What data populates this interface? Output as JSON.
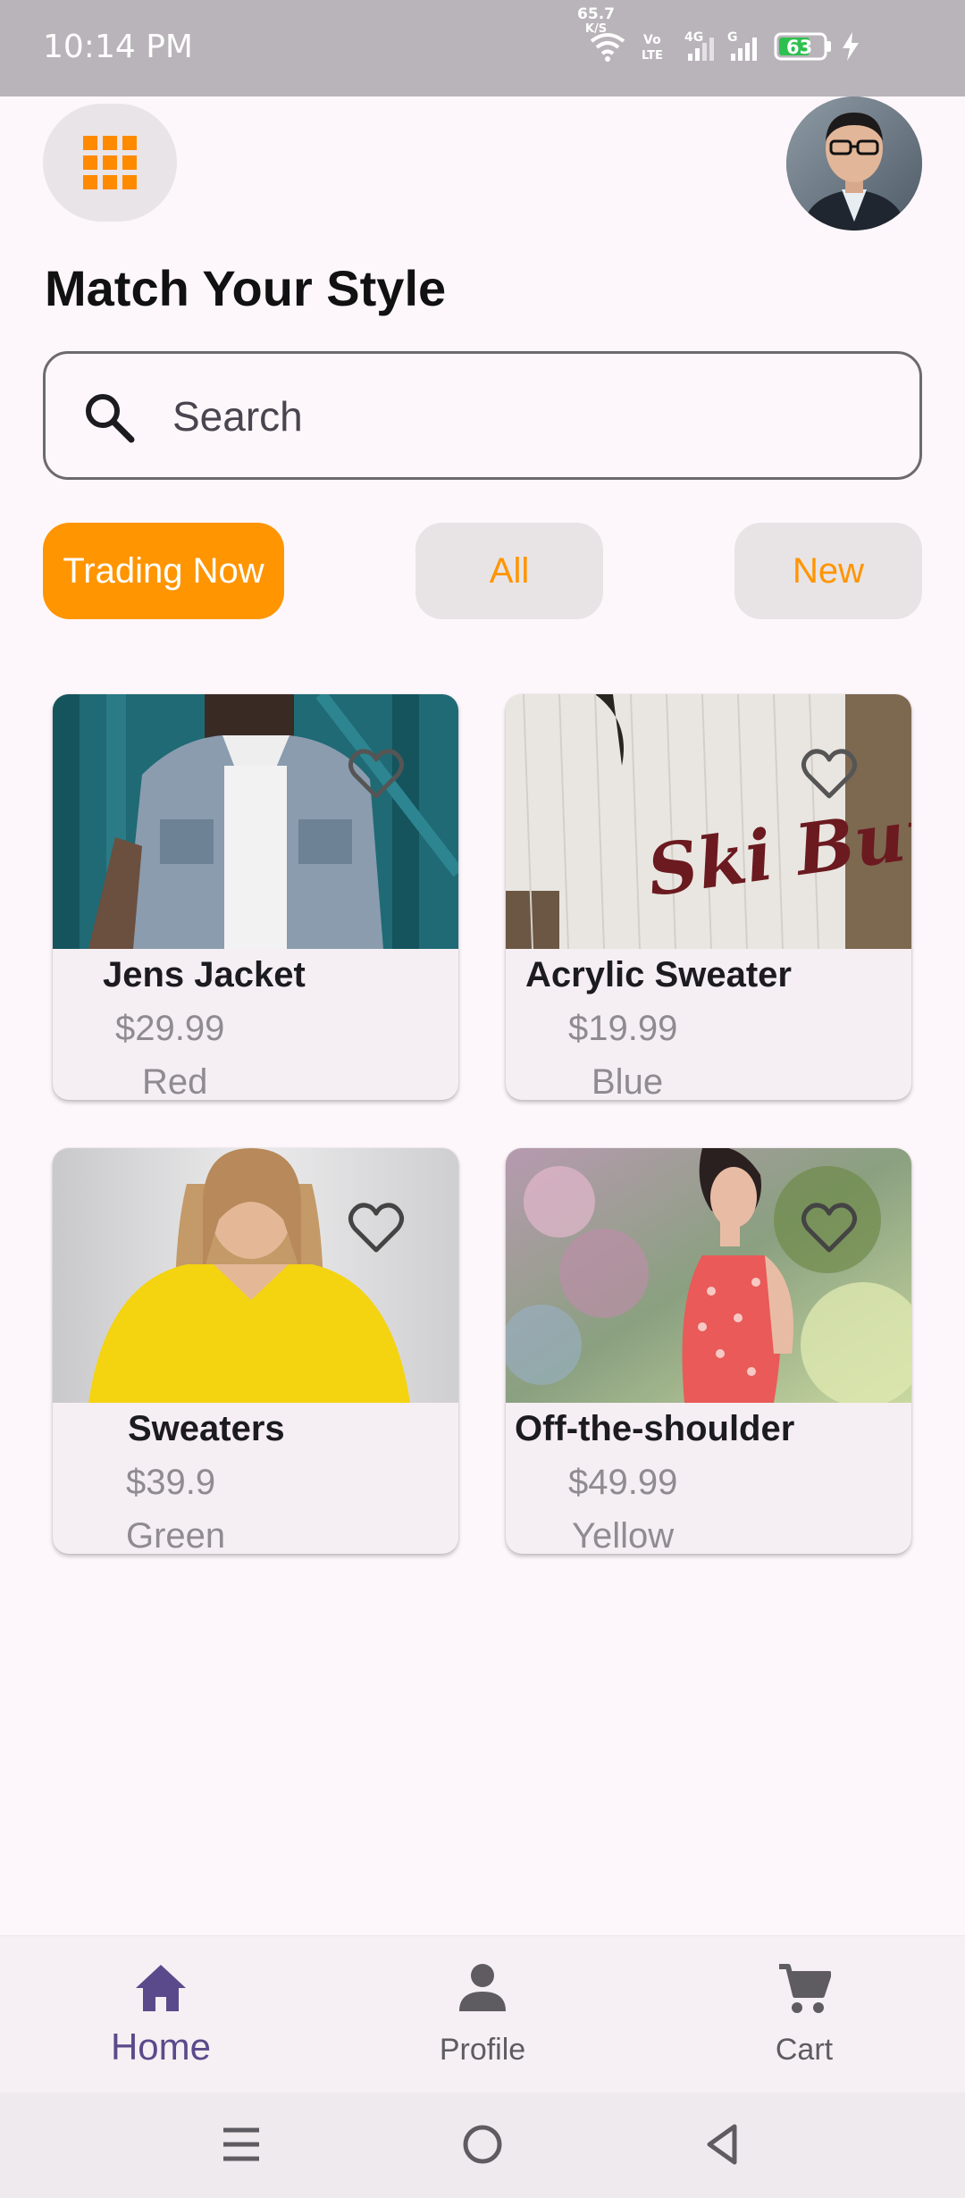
{
  "status_bar": {
    "time": "10:14 PM",
    "net_speed_value": "65.7",
    "net_speed_unit": "K/S",
    "battery": "63",
    "icons": [
      "wifi-icon",
      "volte-icon",
      "4g-signal-icon",
      "signal-icon",
      "battery-icon",
      "charging-icon"
    ]
  },
  "header": {
    "menu_icon": "grid-menu-icon",
    "avatar_icon": "profile-avatar",
    "title": "Match Your Style"
  },
  "search": {
    "placeholder": "Search",
    "value": ""
  },
  "tabs": [
    {
      "label": "Trading Now",
      "active": true
    },
    {
      "label": "All",
      "active": false
    },
    {
      "label": "New",
      "active": false
    }
  ],
  "products": [
    {
      "name": "Jens Jacket",
      "price": "$29.99",
      "color": "Red"
    },
    {
      "name": "Acrylic Sweater",
      "price": "$19.99",
      "color": "Blue"
    },
    {
      "name": "Sweaters",
      "price": "$39.9",
      "color": "Green"
    },
    {
      "name": "Off-the-shoulder",
      "price": "$49.99",
      "color": "Yellow"
    }
  ],
  "bottom_nav": {
    "items": [
      {
        "label": "Home",
        "icon": "home-icon",
        "active": true
      },
      {
        "label": "Profile",
        "icon": "person-icon",
        "active": false
      },
      {
        "label": "Cart",
        "icon": "cart-icon",
        "active": false
      }
    ]
  },
  "colors": {
    "accent": "#ff9500",
    "nav_active": "#5b4a8b",
    "background": "#fdf7fb"
  }
}
